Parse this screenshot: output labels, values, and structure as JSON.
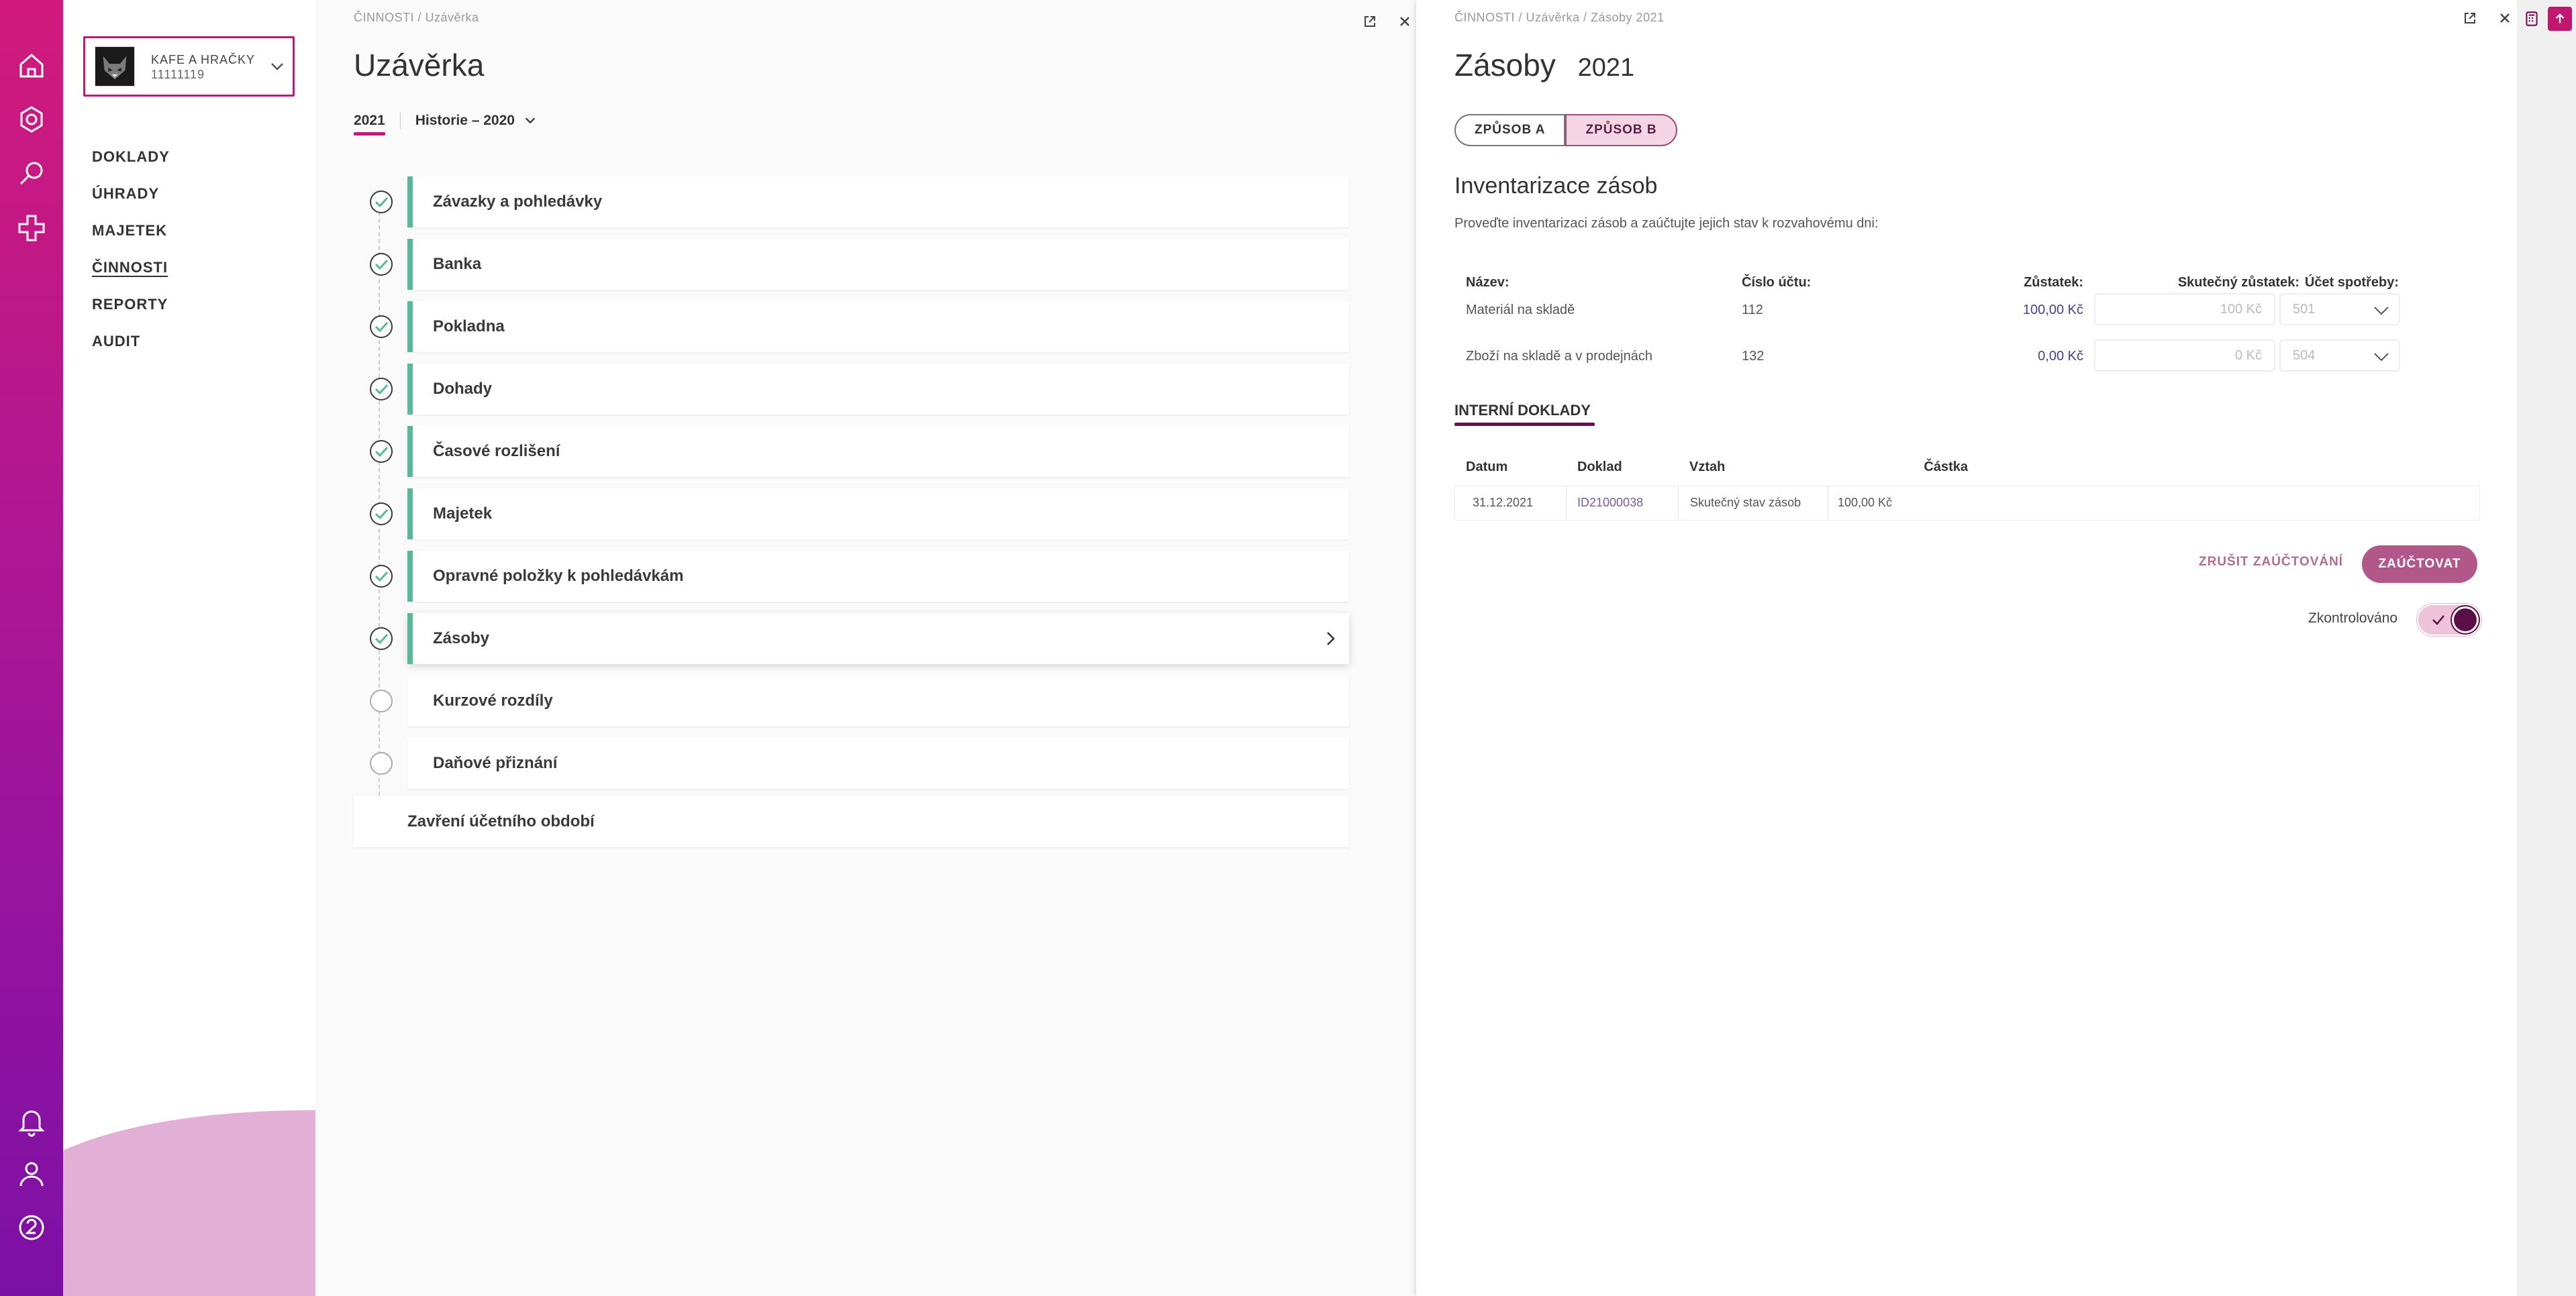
{
  "company": {
    "name": "KAFE A HRAČKY",
    "id": "11111119"
  },
  "nav": {
    "items": [
      "DOKLADY",
      "ÚHRADY",
      "MAJETEK",
      "ČINNOSTI",
      "REPORTY",
      "AUDIT"
    ],
    "active": "ČINNOSTI"
  },
  "left": {
    "breadcrumb": "ČINNOSTI  /  Uzávěrka",
    "title": "Uzávěrka",
    "tabs": {
      "current": "2021",
      "history": "Historie – 2020"
    },
    "steps": [
      {
        "label": "Závazky a pohledávky",
        "done": true
      },
      {
        "label": "Banka",
        "done": true
      },
      {
        "label": "Pokladna",
        "done": true
      },
      {
        "label": "Dohady",
        "done": true
      },
      {
        "label": "Časové rozlišení",
        "done": true
      },
      {
        "label": "Majetek",
        "done": true
      },
      {
        "label": "Opravné položky k pohledávkám",
        "done": true
      },
      {
        "label": "Zásoby",
        "done": true
      },
      {
        "label": "Kurzové rozdíly",
        "done": false
      },
      {
        "label": "Daňové přiznání",
        "done": false
      }
    ],
    "final_step": "Zavření účetního období"
  },
  "right": {
    "breadcrumb": "ČINNOSTI  /  Uzávěrka  /  Zásoby 2021",
    "title": "Zásoby",
    "year": "2021",
    "methods": [
      "ZPŮSOB A",
      "ZPŮSOB B"
    ],
    "section_title": "Inventarizace zásob",
    "section_desc": "Proveďte inventarizaci zásob a zaúčtujte jejich stav k rozvahovému dni:",
    "inventory": {
      "headers": {
        "name": "Název:",
        "account": "Číslo účtu:",
        "balance": "Zůstatek:",
        "actual": "Skutečný zůstatek:",
        "consumption": "Účet spotřeby:"
      },
      "rows": [
        {
          "name": "Materiál na skladě",
          "account": "112",
          "balance": "100,00 Kč",
          "actual": "100 Kč",
          "consumption": "501"
        },
        {
          "name": "Zboží na skladě a v prodejnách",
          "account": "132",
          "balance": "0,00 Kč",
          "actual": "0 Kč",
          "consumption": "504"
        }
      ]
    },
    "internal_tab": "INTERNÍ DOKLADY",
    "docs": {
      "headers": {
        "date": "Datum",
        "doc": "Doklad",
        "relation": "Vztah",
        "amount": "Částka"
      },
      "rows": [
        {
          "date": "31.12.2021",
          "doc": "ID21000038",
          "relation": "Skutečný stav zásob",
          "amount": "100,00 Kč"
        }
      ]
    },
    "cancel_label": "ZRUŠIT ZAÚČTOVÁNÍ",
    "post_label": "ZAÚČTOVAT",
    "checked_label": "Zkontrolováno",
    "checked": true
  },
  "colors": {
    "accent": "#c2187f",
    "done": "#55b99a",
    "dark": "#5a0f46"
  }
}
